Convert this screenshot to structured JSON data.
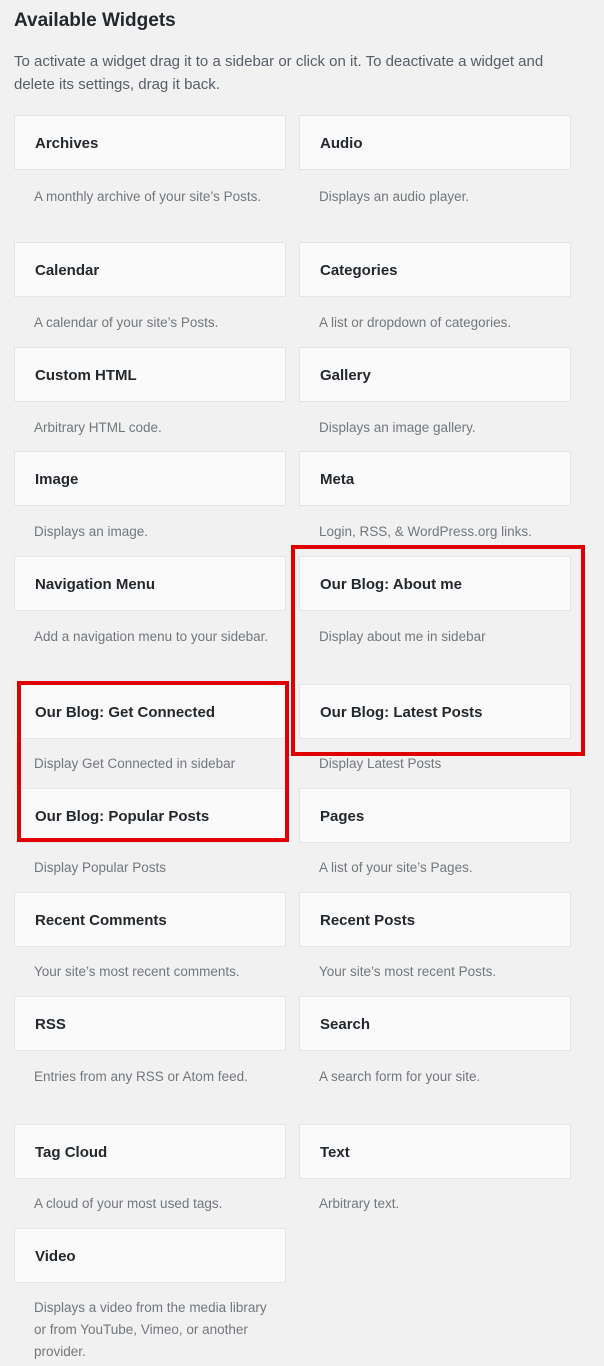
{
  "header": {
    "title": "Available Widgets",
    "description": "To activate a widget drag it to a sidebar or click on it. To deactivate a widget and delete its settings, drag it back."
  },
  "widgets": [
    {
      "title": "Archives",
      "desc": "A monthly archive of your site’s Posts."
    },
    {
      "title": "Audio",
      "desc": "Displays an audio player."
    },
    {
      "title": "Calendar",
      "desc": "A calendar of your site’s Posts."
    },
    {
      "title": "Categories",
      "desc": "A list or dropdown of categories."
    },
    {
      "title": "Custom HTML",
      "desc": "Arbitrary HTML code."
    },
    {
      "title": "Gallery",
      "desc": "Displays an image gallery."
    },
    {
      "title": "Image",
      "desc": "Displays an image."
    },
    {
      "title": "Meta",
      "desc": "Login, RSS, & WordPress.org links."
    },
    {
      "title": "Navigation Menu",
      "desc": "Add a navigation menu to your sidebar."
    },
    {
      "title": "Our Blog: About me",
      "desc": "Display about me in sidebar"
    },
    {
      "title": "Our Blog: Get Connected",
      "desc": "Display Get Connected in sidebar"
    },
    {
      "title": "Our Blog: Latest Posts",
      "desc": "Display Latest Posts"
    },
    {
      "title": "Our Blog: Popular Posts",
      "desc": "Display Popular Posts"
    },
    {
      "title": "Pages",
      "desc": "A list of your site’s Pages."
    },
    {
      "title": "Recent Comments",
      "desc": "Your site’s most recent comments."
    },
    {
      "title": "Recent Posts",
      "desc": "Your site’s most recent Posts."
    },
    {
      "title": "RSS",
      "desc": "Entries from any RSS or Atom feed."
    },
    {
      "title": "Search",
      "desc": "A search form for your site."
    },
    {
      "title": "Tag Cloud",
      "desc": "A cloud of your most used tags."
    },
    {
      "title": "Text",
      "desc": "Arbitrary text."
    },
    {
      "title": "Video",
      "desc": "Displays a video from the media library or from YouTube, Vimeo, or another provider."
    }
  ],
  "highlight_color": "#e00000"
}
